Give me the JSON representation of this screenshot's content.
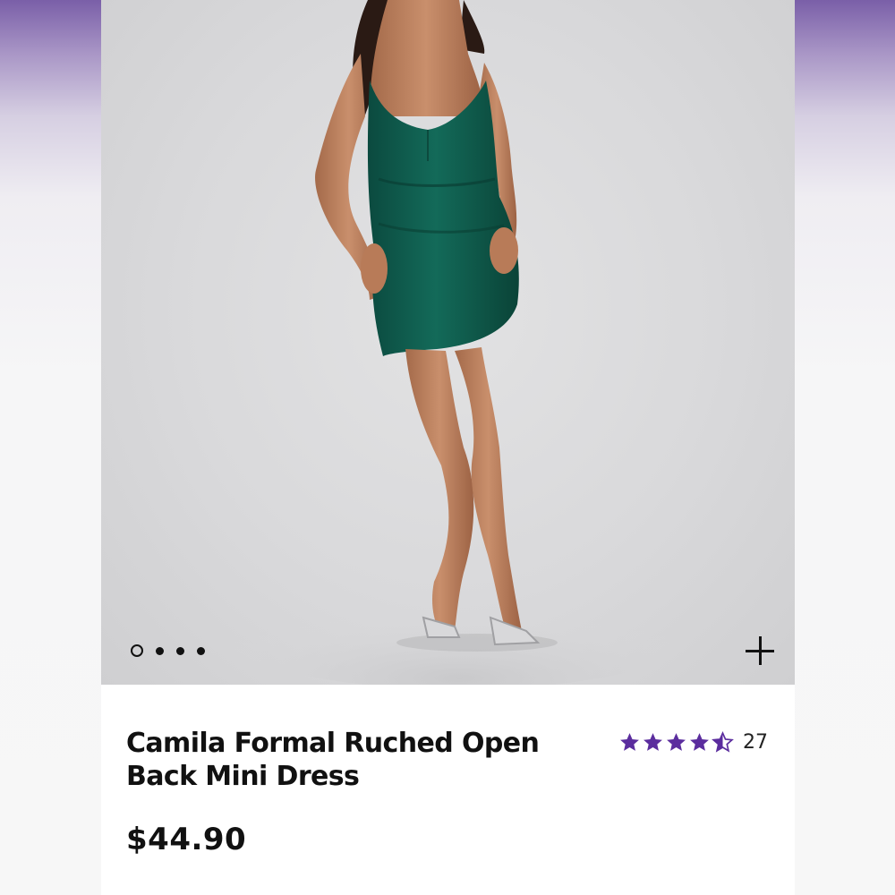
{
  "product": {
    "title": "Camila Formal Ruched Open Back Mini Dress",
    "price": "$44.90",
    "rating": 4.5,
    "review_count": "27",
    "dress_color": "#0f5a4c"
  },
  "gallery": {
    "total_images": 4,
    "active_index": 0,
    "zoom_icon": "plus-icon"
  },
  "colors": {
    "star": "#5b2d9e",
    "text": "#111111",
    "brand_purple": "#7a5fa8"
  }
}
